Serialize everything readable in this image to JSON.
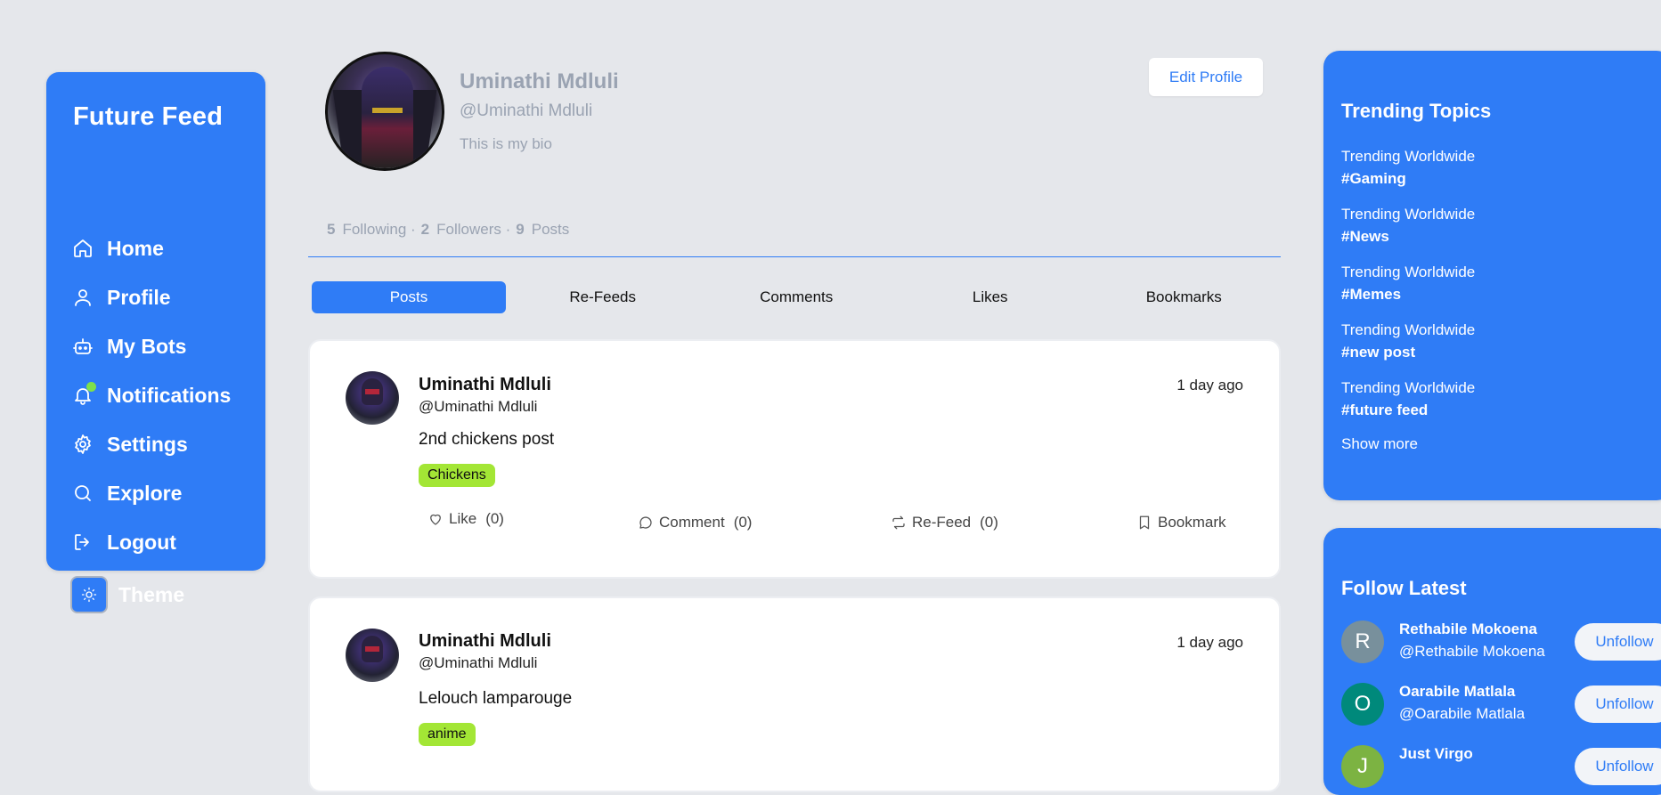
{
  "app": {
    "brand": "Future Feed"
  },
  "nav": [
    {
      "label": "Home",
      "icon": "home-icon"
    },
    {
      "label": "Profile",
      "icon": "user-icon"
    },
    {
      "label": "My Bots",
      "icon": "bot-icon"
    },
    {
      "label": "Notifications",
      "icon": "bell-icon"
    },
    {
      "label": "Settings",
      "icon": "gear-icon"
    },
    {
      "label": "Explore",
      "icon": "search-icon"
    },
    {
      "label": "Logout",
      "icon": "logout-icon"
    },
    {
      "label": "Theme",
      "icon": "sun-icon"
    }
  ],
  "profile": {
    "name": "Uminathi Mdluli",
    "handle": "@Uminathi Mdluli",
    "bio": "This is my bio",
    "edit_label": "Edit Profile",
    "stats": {
      "following_count": "5",
      "following_label": "Following ·",
      "followers_count": "2",
      "followers_label": "Followers ·",
      "posts_count": "9",
      "posts_label": "Posts"
    }
  },
  "tabs": [
    {
      "label": "Posts",
      "active": true
    },
    {
      "label": "Re-Feeds",
      "active": false
    },
    {
      "label": "Comments",
      "active": false
    },
    {
      "label": "Likes",
      "active": false
    },
    {
      "label": "Bookmarks",
      "active": false
    }
  ],
  "posts": [
    {
      "name": "Uminathi Mdluli",
      "handle": "@Uminathi Mdluli",
      "time": "1 day ago",
      "text": "2nd chickens post",
      "tag": "Chickens",
      "like_label": "Like",
      "like_count": "(0)",
      "comment_label": "Comment",
      "comment_count": "(0)",
      "refeed_label": "Re-Feed",
      "refeed_count": "(0)",
      "bookmark_label": "Bookmark"
    },
    {
      "name": "Uminathi Mdluli",
      "handle": "@Uminathi Mdluli",
      "time": "1 day ago",
      "text": "Lelouch lamparouge",
      "tag": "anime"
    }
  ],
  "trending": {
    "title": "Trending Topics",
    "items": [
      {
        "label": "Trending Worldwide",
        "tag": "#Gaming"
      },
      {
        "label": "Trending Worldwide",
        "tag": "#News"
      },
      {
        "label": "Trending Worldwide",
        "tag": "#Memes"
      },
      {
        "label": "Trending Worldwide",
        "tag": "#new post"
      },
      {
        "label": "Trending Worldwide",
        "tag": "#future feed"
      }
    ],
    "show_more": "Show more"
  },
  "follow_latest": {
    "title": "Follow Latest",
    "users": [
      {
        "initial": "R",
        "name": "Rethabile Mokoena",
        "handle": "@Rethabile Mokoena",
        "button": "Unfollow",
        "color": "#78909c"
      },
      {
        "initial": "O",
        "name": "Oarabile Matlala",
        "handle": "@Oarabile Matlala",
        "button": "Unfollow",
        "color": "#00897b"
      },
      {
        "initial": "J",
        "name": "Just Virgo",
        "handle": "",
        "button": "Unfollow",
        "color": "#7cb342"
      }
    ]
  },
  "colors": {
    "accent": "#2f7cf6",
    "tag": "#a3e635",
    "background": "#e5e7eb",
    "online_dot": "#7ee04a"
  }
}
